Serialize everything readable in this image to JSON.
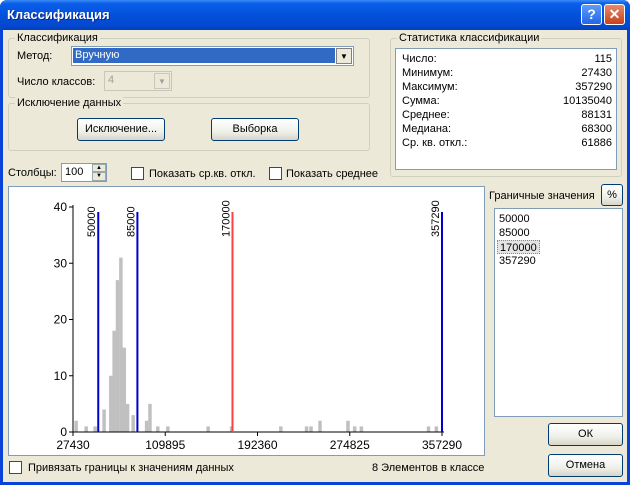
{
  "window": {
    "title": "Классификация",
    "help_label": "?",
    "close_label": "✕"
  },
  "classification": {
    "group_title": "Классификация",
    "method_label": "Метод:",
    "method_value": "Вручную",
    "num_classes_label": "Число классов:",
    "num_classes_value": "4"
  },
  "exclusion": {
    "group_title": "Исключение данных",
    "exclusion_button": "Исключение...",
    "sample_button": "Выборка"
  },
  "stats": {
    "group_title": "Статистика классификации",
    "rows": [
      {
        "label": "Число:",
        "value": "115"
      },
      {
        "label": "Минимум:",
        "value": "27430"
      },
      {
        "label": "Максимум:",
        "value": "357290"
      },
      {
        "label": "Сумма:",
        "value": "10135040"
      },
      {
        "label": "Среднее:",
        "value": "88131"
      },
      {
        "label": "Медиана:",
        "value": "68300"
      },
      {
        "label": "Ср. кв. откл.:",
        "value": "61886"
      }
    ]
  },
  "options": {
    "columns_label": "Столбцы:",
    "columns_value": "100",
    "show_std_label": "Показать ср.кв. откл.",
    "show_mean_label": "Показать среднее"
  },
  "breaks": {
    "header": "Граничные значения",
    "percent_label": "%",
    "values": [
      "50000",
      "85000",
      "170000",
      "357290"
    ],
    "selected_index": 2
  },
  "footer": {
    "snap_label": "Привязать границы к значениям данных",
    "class_count_text": "8 Элементов в классе",
    "ok_label": "ОК",
    "cancel_label": "Отмена"
  },
  "chart_data": {
    "type": "bar",
    "xlim": [
      27430,
      357290
    ],
    "ylim": [
      0,
      40
    ],
    "x_ticks": [
      "27430",
      "109895",
      "192360",
      "274825",
      "357290"
    ],
    "y_ticks": [
      "0",
      "10",
      "20",
      "30",
      "40"
    ],
    "bins": [
      {
        "x": 30000,
        "value": 2
      },
      {
        "x": 39000,
        "value": 1
      },
      {
        "x": 47000,
        "value": 1
      },
      {
        "x": 55000,
        "value": 4
      },
      {
        "x": 61000,
        "value": 10
      },
      {
        "x": 64000,
        "value": 18
      },
      {
        "x": 67000,
        "value": 27
      },
      {
        "x": 70000,
        "value": 31
      },
      {
        "x": 73000,
        "value": 15
      },
      {
        "x": 76000,
        "value": 5
      },
      {
        "x": 81000,
        "value": 3
      },
      {
        "x": 93000,
        "value": 2
      },
      {
        "x": 96000,
        "value": 5
      },
      {
        "x": 103000,
        "value": 1
      },
      {
        "x": 112000,
        "value": 1
      },
      {
        "x": 148000,
        "value": 1
      },
      {
        "x": 169000,
        "value": 1
      },
      {
        "x": 213000,
        "value": 1
      },
      {
        "x": 236000,
        "value": 1
      },
      {
        "x": 240000,
        "value": 1
      },
      {
        "x": 248000,
        "value": 2
      },
      {
        "x": 273000,
        "value": 2
      },
      {
        "x": 279000,
        "value": 1
      },
      {
        "x": 285000,
        "value": 1
      },
      {
        "x": 345000,
        "value": 1
      },
      {
        "x": 352000,
        "value": 1
      }
    ],
    "break_lines": [
      {
        "value": 50000,
        "label": "50000",
        "color": "#0000cc"
      },
      {
        "value": 85000,
        "label": "85000",
        "color": "#0000cc"
      },
      {
        "value": 170000,
        "label": "170000",
        "color": "#ff4040"
      },
      {
        "value": 357290,
        "label": "357290",
        "color": "#0000cc"
      }
    ],
    "bar_color": "#c0c0c0"
  }
}
